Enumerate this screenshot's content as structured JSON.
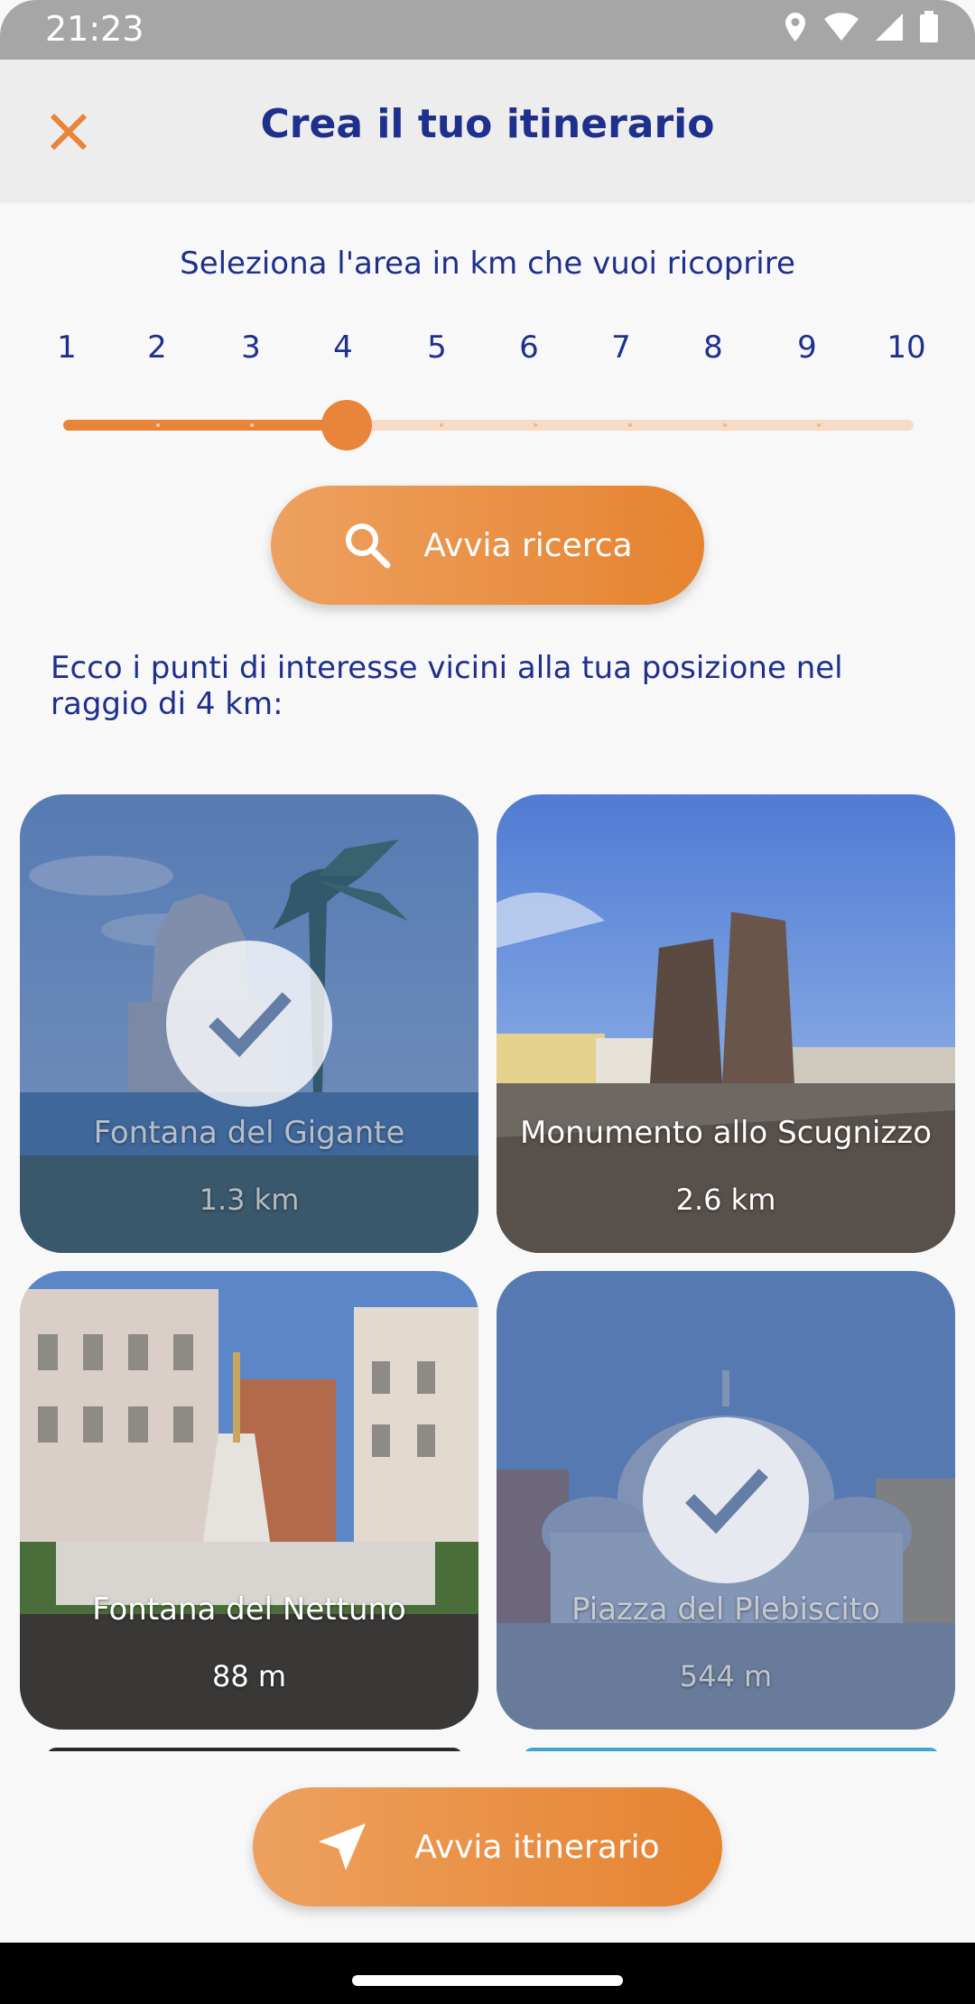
{
  "status_bar": {
    "time": "21:23",
    "icons": [
      "location-icon",
      "wifi-icon",
      "cellular-icon",
      "battery-icon"
    ]
  },
  "header": {
    "title": "Crea il tuo itinerario",
    "close_icon": "close-icon",
    "accent_color": "#e8853a",
    "title_color": "#1e2f8c"
  },
  "area_selector": {
    "label": "Seleziona l'area in km che vuoi ricoprire",
    "options": [
      "1",
      "2",
      "3",
      "4",
      "5",
      "6",
      "7",
      "8",
      "9",
      "10"
    ],
    "selected_value": 4
  },
  "search_button": {
    "label": "Avvia ricerca",
    "icon": "search-icon"
  },
  "results": {
    "text": "Ecco i punti di interesse vicini alla tua posizione nel raggio di 4 km:"
  },
  "places": [
    {
      "name": "Fontana del Gigante",
      "distance": "1.3 km",
      "selected": true
    },
    {
      "name": "Monumento allo Scugnizzo",
      "distance": "2.6 km",
      "selected": false
    },
    {
      "name": "Fontana del Nettuno",
      "distance": "88 m",
      "selected": false
    },
    {
      "name": "Piazza del Plebiscito",
      "distance": "544 m",
      "selected": true
    }
  ],
  "itinerary_button": {
    "label": "Avvia itinerario",
    "icon": "navigation-arrow-icon"
  }
}
